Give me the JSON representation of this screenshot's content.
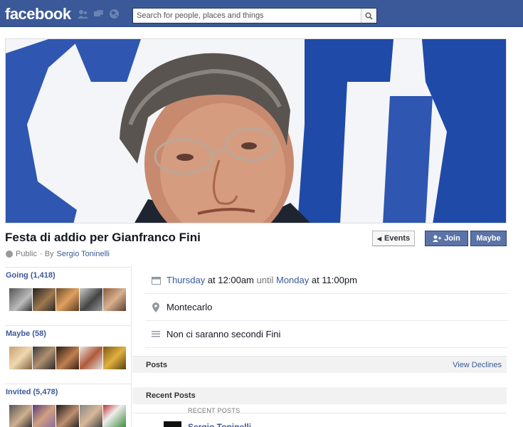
{
  "app": {
    "logo": "facebook",
    "brand_color": "#3b5998"
  },
  "search": {
    "placeholder": "Search for people, places and things"
  },
  "event": {
    "title": "Festa di addio per Gianfranco Fini",
    "privacy": "Public",
    "by_prefix": "· By",
    "host": "Sergio Toninelli"
  },
  "buttons": {
    "events": "Events",
    "join": "Join",
    "maybe": "Maybe"
  },
  "guests": {
    "going": {
      "label": "Going (1,418)"
    },
    "maybe": {
      "label": "Maybe (58)"
    },
    "invited": {
      "label": "Invited (5,478)"
    }
  },
  "details": {
    "start_day": "Thursday",
    "start_time": "at 12:00am",
    "until": "until",
    "end_day": "Monday",
    "end_time": "at 11:00pm",
    "location": "Montecarlo",
    "description": "Non ci saranno secondi Fini"
  },
  "posts": {
    "header": "Posts",
    "view_declines": "View Declines",
    "recent_header": "Recent Posts",
    "recent_label": "RECENT POSTS",
    "first_author": "Sergio Toninelli"
  }
}
